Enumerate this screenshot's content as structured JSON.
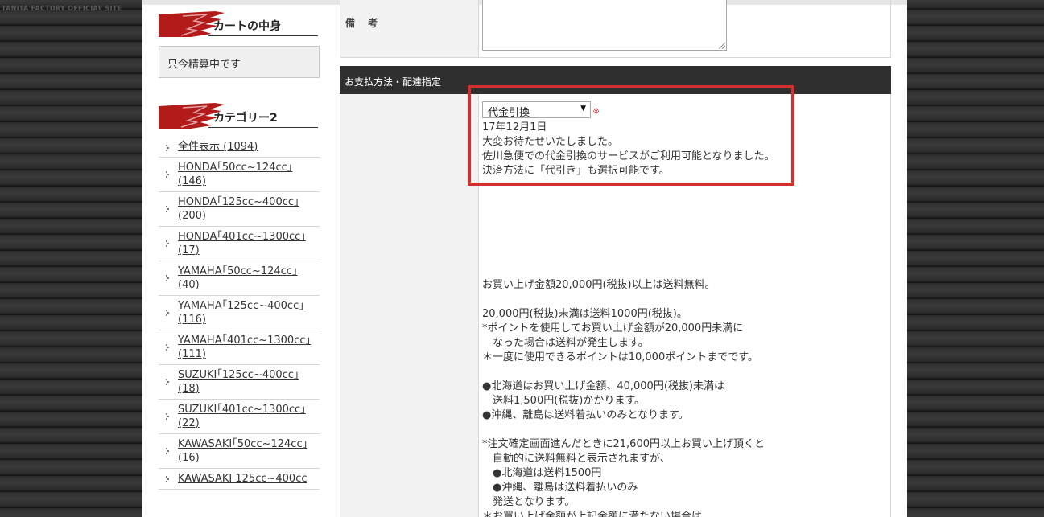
{
  "site_label": "TANITA FACTORY OFFICIAL SITE",
  "sidebar": {
    "cart_title": "カートの中身",
    "cart_status": "只今精算中です",
    "category_title": "カテゴリー2",
    "categories": [
      "全件表示 (1094)",
      "HONDA｢50cc~124cc｣(146)",
      "HONDA｢125cc~400cc｣(200)",
      "HONDA｢401cc~1300cc｣(17)",
      "YAMAHA｢50cc~124cc｣(40)",
      "YAMAHA｢125cc~400cc｣(116)",
      "YAMAHA｢401cc~1300cc｣(111)",
      "SUZUKI｢125cc~400cc｣(18)",
      "SUZUKI｢401cc~1300cc｣(22)",
      "KAWASAKI｢50cc~124cc｣(16)",
      "KAWASAKI 125cc~400cc"
    ]
  },
  "form": {
    "note_label": "備 考",
    "payment_header": "お支払方法・配達指定",
    "payment_selected": "代金引換",
    "required_mark": "※",
    "notice_lines": [
      "17年12月1日",
      "大変お待たせいたしました。",
      "佐川急便での代金引換のサービスがご利用可能となりました。",
      "決済方法に「代引き」も選択可能です。"
    ],
    "shipping_text": "お買い上げ金額20,000円(税抜)以上は送料無料。\n\n20,000円(税抜)未満は送料1000円(税抜)。\n*ポイントを使用してお買い上げ金額が20,000円未満に\n　なった場合は送料が発生します。\n＊一度に使用できるポイントは10,000ポイントまでです。\n\n●北海道はお買い上げ金額、40,000円(税抜)未満は\n　送料1,500円(税抜)かかります。\n●沖縄、離島は送料着払いのみとなります。\n\n*注文確定画面進んだときに21,600円以上お買い上げ頂くと\n　自動的に送料無料と表示されますが、\n　●北海道は送料1500円\n　●沖縄、離島は送料着払いのみ\n　発送となります。\n＊お買い上げ金額が上記金額に満たない場合は"
  },
  "colors": {
    "highlight": "#d42f2f",
    "header_bg": "#2f2f2f",
    "brand_red": "#b31b1b"
  }
}
